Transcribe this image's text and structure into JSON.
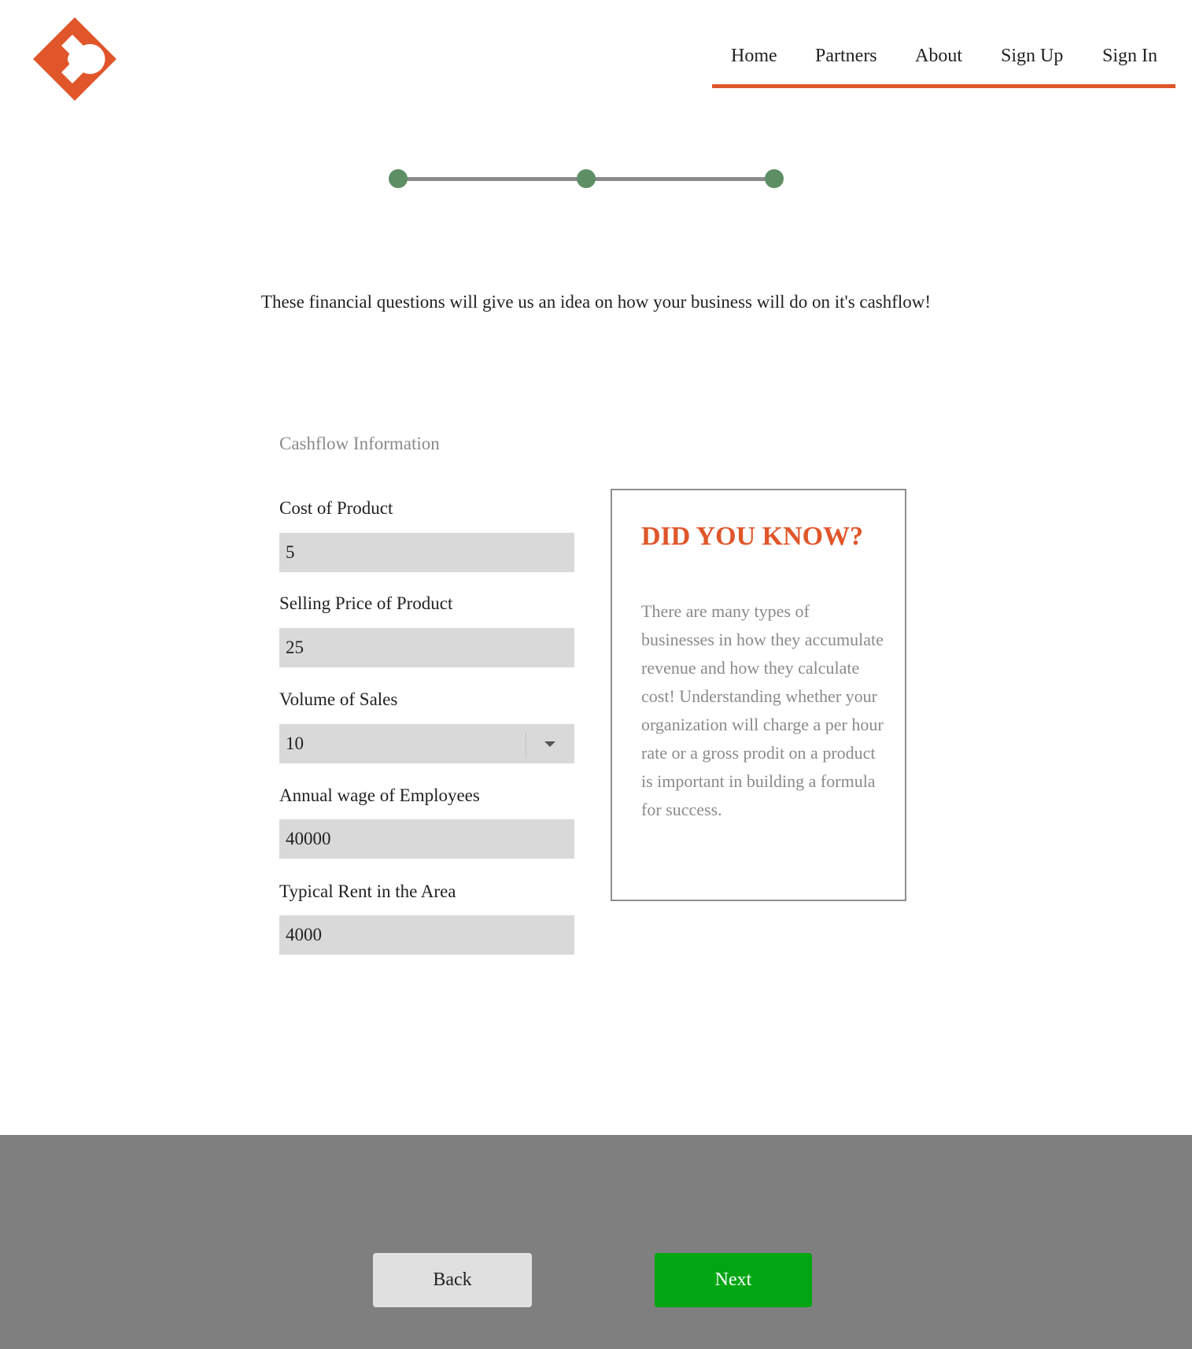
{
  "brand": {
    "logo_icon": "orange-diamond-logo-icon",
    "accent_color": "#e0562a"
  },
  "nav": {
    "items": [
      {
        "label": "Home"
      },
      {
        "label": "Partners"
      },
      {
        "label": "About"
      },
      {
        "label": "Sign Up"
      },
      {
        "label": "Sign In"
      }
    ]
  },
  "stepper": {
    "steps": 3,
    "dot_color": "#5e8e64",
    "track_color": "#8a8a8a"
  },
  "intro": {
    "text": "These financial questions will give us an idea on how your business will do on it's cashflow!"
  },
  "form": {
    "section_title": "Cashflow Information",
    "fields": {
      "cost_of_product": {
        "label": "Cost of Product",
        "value": "5"
      },
      "selling_price": {
        "label": "Selling Price of Product",
        "value": "25"
      },
      "volume_of_sales": {
        "label": "Volume of Sales",
        "value": "10"
      },
      "annual_wage": {
        "label": "Annual wage of Employees",
        "value": "40000"
      },
      "typical_rent": {
        "label": "Typical Rent in the Area",
        "value": "4000"
      }
    }
  },
  "info_card": {
    "title": "DID YOU KNOW?",
    "body": "There are many types of businesses in how they accumulate revenue and how they calculate cost! Understanding whether your organization will charge a per hour rate or a gross prodit on a product is important in building a formula for success."
  },
  "footer": {
    "background_color": "#7f7f7f",
    "back_label": "Back",
    "next_label": "Next",
    "next_color": "#00a613"
  }
}
